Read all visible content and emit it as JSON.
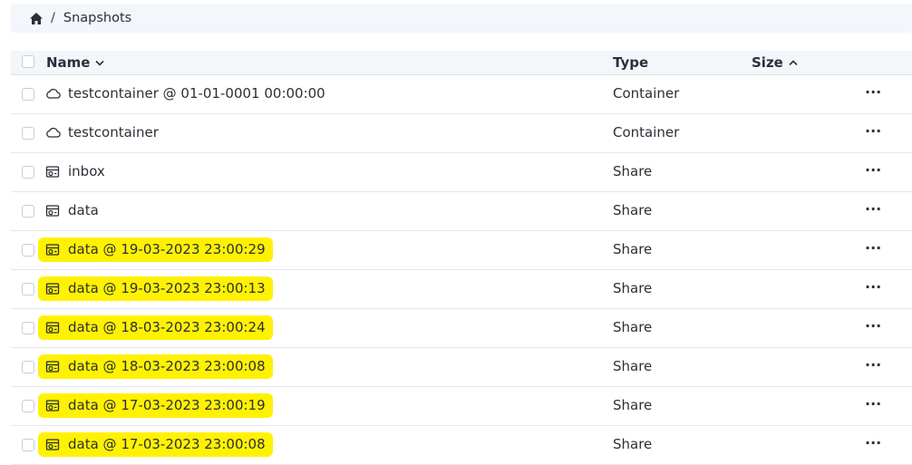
{
  "breadcrumb": {
    "home_icon": "home-icon",
    "separator": "/",
    "current": "Snapshots"
  },
  "table": {
    "headers": {
      "name": "Name",
      "type": "Type",
      "size": "Size"
    },
    "sort": {
      "name": "descending",
      "size": "ascending"
    },
    "rows": [
      {
        "name": "testcontainer @ 01-01-0001 00:00:00",
        "type": "Container",
        "icon": "cloud-icon",
        "highlighted": false
      },
      {
        "name": "testcontainer",
        "type": "Container",
        "icon": "cloud-icon",
        "highlighted": false
      },
      {
        "name": "inbox",
        "type": "Share",
        "icon": "share-drive-icon",
        "highlighted": false
      },
      {
        "name": "data",
        "type": "Share",
        "icon": "share-drive-icon",
        "highlighted": false
      },
      {
        "name": "data @ 19-03-2023 23:00:29",
        "type": "Share",
        "icon": "share-drive-icon",
        "highlighted": true
      },
      {
        "name": "data @ 19-03-2023 23:00:13",
        "type": "Share",
        "icon": "share-drive-icon",
        "highlighted": true
      },
      {
        "name": "data @ 18-03-2023 23:00:24",
        "type": "Share",
        "icon": "share-drive-icon",
        "highlighted": true
      },
      {
        "name": "data @ 18-03-2023 23:00:08",
        "type": "Share",
        "icon": "share-drive-icon",
        "highlighted": true
      },
      {
        "name": "data @ 17-03-2023 23:00:19",
        "type": "Share",
        "icon": "share-drive-icon",
        "highlighted": true
      },
      {
        "name": "data @ 17-03-2023 23:00:08",
        "type": "Share",
        "icon": "share-drive-icon",
        "highlighted": true
      }
    ],
    "more_label": "···",
    "highlight_color": "#fff200"
  }
}
